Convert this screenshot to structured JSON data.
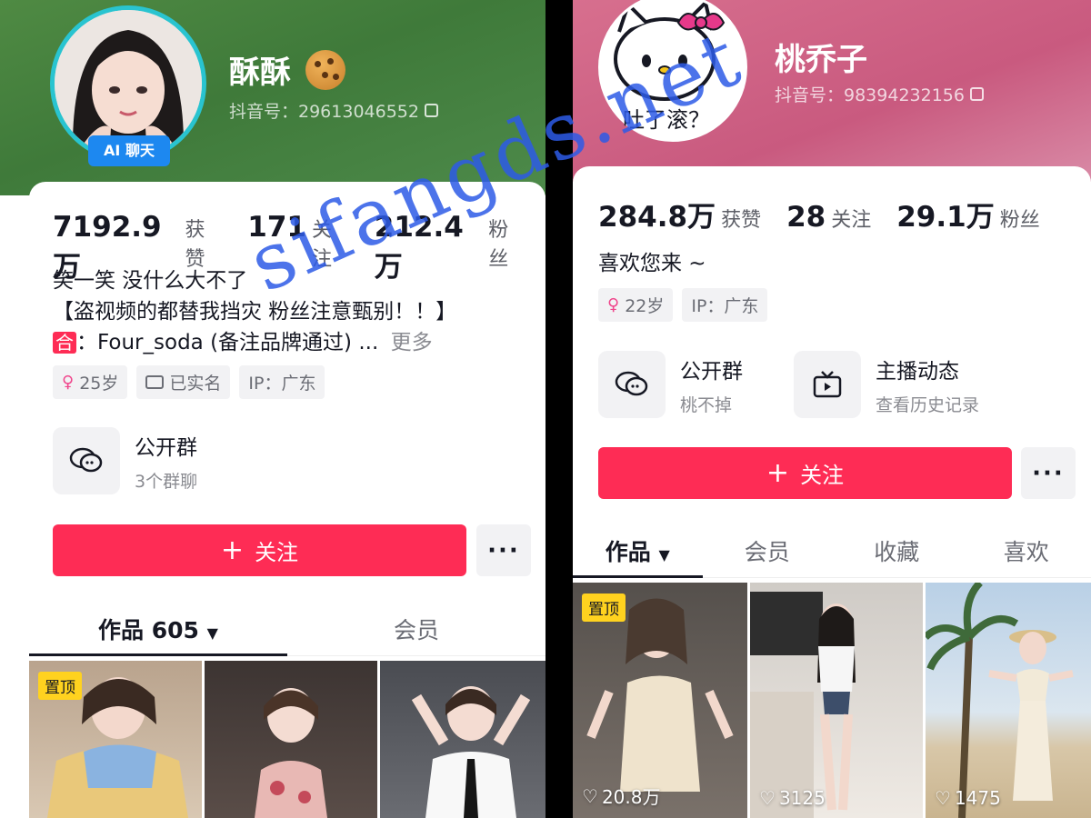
{
  "left": {
    "name": "酥酥",
    "douyin_id": "抖音号：29613046552",
    "ai_badge": "AI 聊天",
    "stats": [
      {
        "num": "7192.9万",
        "label": "获赞"
      },
      {
        "num": "171",
        "label": "关注"
      },
      {
        "num": "212.4万",
        "label": "粉丝"
      }
    ],
    "bio": [
      "笑一笑 没什么大不了",
      "【盗视频的都替我挡灾 粉丝注意甄别！！】"
    ],
    "bio_line3_prefix": "合",
    "bio_line3": "：Four_soda (备注品牌通过) ...",
    "bio_more": "更多",
    "tags": {
      "age": "25岁",
      "verified": "已实名",
      "ip": "IP：广东"
    },
    "group": {
      "title": "公开群",
      "subtitle": "3个群聊"
    },
    "follow_label": "关注",
    "more_label": "···",
    "tabs": [
      "作品 605",
      "会员"
    ],
    "pin_label": "置顶"
  },
  "right": {
    "name": "桃乔子",
    "douyin_id": "抖音号：98394232156",
    "avatar_caption": "吐了滚？",
    "stats": [
      {
        "num": "284.8万",
        "label": "获赞"
      },
      {
        "num": "28",
        "label": "关注"
      },
      {
        "num": "29.1万",
        "label": "粉丝"
      }
    ],
    "bio": "喜欢您来 ~",
    "tags": {
      "age": "22岁",
      "ip": "IP：广东"
    },
    "group": {
      "title": "公开群",
      "subtitle": "桃不掉"
    },
    "live": {
      "title": "主播动态",
      "subtitle": "查看历史记录"
    },
    "follow_label": "关注",
    "more_label": "···",
    "tabs": [
      "作品",
      "会员",
      "收藏",
      "喜欢"
    ],
    "pin_label": "置顶",
    "likes": [
      "20.8万",
      "3125",
      "1475"
    ]
  },
  "watermark": "sifangds.net",
  "colors": {
    "accent": "#fe2c55",
    "pin": "#ffd21f",
    "ai_badge": "#1d88f0"
  }
}
